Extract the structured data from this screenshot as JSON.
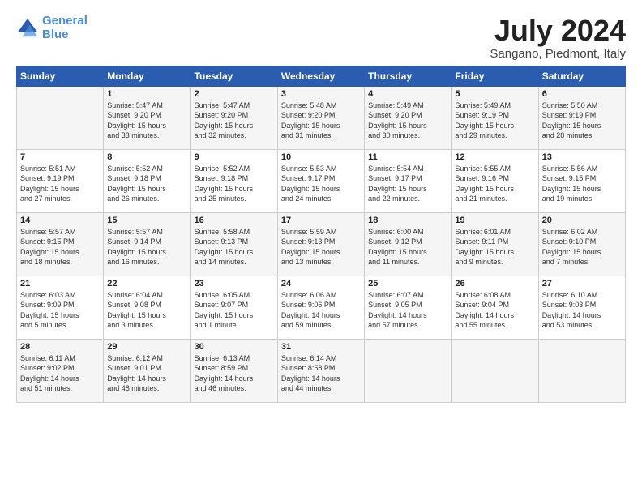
{
  "header": {
    "logo_line1": "General",
    "logo_line2": "Blue",
    "title": "July 2024",
    "location": "Sangano, Piedmont, Italy"
  },
  "days_of_week": [
    "Sunday",
    "Monday",
    "Tuesday",
    "Wednesday",
    "Thursday",
    "Friday",
    "Saturday"
  ],
  "weeks": [
    [
      {
        "day": "",
        "info": ""
      },
      {
        "day": "1",
        "info": "Sunrise: 5:47 AM\nSunset: 9:20 PM\nDaylight: 15 hours\nand 33 minutes."
      },
      {
        "day": "2",
        "info": "Sunrise: 5:47 AM\nSunset: 9:20 PM\nDaylight: 15 hours\nand 32 minutes."
      },
      {
        "day": "3",
        "info": "Sunrise: 5:48 AM\nSunset: 9:20 PM\nDaylight: 15 hours\nand 31 minutes."
      },
      {
        "day": "4",
        "info": "Sunrise: 5:49 AM\nSunset: 9:20 PM\nDaylight: 15 hours\nand 30 minutes."
      },
      {
        "day": "5",
        "info": "Sunrise: 5:49 AM\nSunset: 9:19 PM\nDaylight: 15 hours\nand 29 minutes."
      },
      {
        "day": "6",
        "info": "Sunrise: 5:50 AM\nSunset: 9:19 PM\nDaylight: 15 hours\nand 28 minutes."
      }
    ],
    [
      {
        "day": "7",
        "info": "Sunrise: 5:51 AM\nSunset: 9:19 PM\nDaylight: 15 hours\nand 27 minutes."
      },
      {
        "day": "8",
        "info": "Sunrise: 5:52 AM\nSunset: 9:18 PM\nDaylight: 15 hours\nand 26 minutes."
      },
      {
        "day": "9",
        "info": "Sunrise: 5:52 AM\nSunset: 9:18 PM\nDaylight: 15 hours\nand 25 minutes."
      },
      {
        "day": "10",
        "info": "Sunrise: 5:53 AM\nSunset: 9:17 PM\nDaylight: 15 hours\nand 24 minutes."
      },
      {
        "day": "11",
        "info": "Sunrise: 5:54 AM\nSunset: 9:17 PM\nDaylight: 15 hours\nand 22 minutes."
      },
      {
        "day": "12",
        "info": "Sunrise: 5:55 AM\nSunset: 9:16 PM\nDaylight: 15 hours\nand 21 minutes."
      },
      {
        "day": "13",
        "info": "Sunrise: 5:56 AM\nSunset: 9:15 PM\nDaylight: 15 hours\nand 19 minutes."
      }
    ],
    [
      {
        "day": "14",
        "info": "Sunrise: 5:57 AM\nSunset: 9:15 PM\nDaylight: 15 hours\nand 18 minutes."
      },
      {
        "day": "15",
        "info": "Sunrise: 5:57 AM\nSunset: 9:14 PM\nDaylight: 15 hours\nand 16 minutes."
      },
      {
        "day": "16",
        "info": "Sunrise: 5:58 AM\nSunset: 9:13 PM\nDaylight: 15 hours\nand 14 minutes."
      },
      {
        "day": "17",
        "info": "Sunrise: 5:59 AM\nSunset: 9:13 PM\nDaylight: 15 hours\nand 13 minutes."
      },
      {
        "day": "18",
        "info": "Sunrise: 6:00 AM\nSunset: 9:12 PM\nDaylight: 15 hours\nand 11 minutes."
      },
      {
        "day": "19",
        "info": "Sunrise: 6:01 AM\nSunset: 9:11 PM\nDaylight: 15 hours\nand 9 minutes."
      },
      {
        "day": "20",
        "info": "Sunrise: 6:02 AM\nSunset: 9:10 PM\nDaylight: 15 hours\nand 7 minutes."
      }
    ],
    [
      {
        "day": "21",
        "info": "Sunrise: 6:03 AM\nSunset: 9:09 PM\nDaylight: 15 hours\nand 5 minutes."
      },
      {
        "day": "22",
        "info": "Sunrise: 6:04 AM\nSunset: 9:08 PM\nDaylight: 15 hours\nand 3 minutes."
      },
      {
        "day": "23",
        "info": "Sunrise: 6:05 AM\nSunset: 9:07 PM\nDaylight: 15 hours\nand 1 minute."
      },
      {
        "day": "24",
        "info": "Sunrise: 6:06 AM\nSunset: 9:06 PM\nDaylight: 14 hours\nand 59 minutes."
      },
      {
        "day": "25",
        "info": "Sunrise: 6:07 AM\nSunset: 9:05 PM\nDaylight: 14 hours\nand 57 minutes."
      },
      {
        "day": "26",
        "info": "Sunrise: 6:08 AM\nSunset: 9:04 PM\nDaylight: 14 hours\nand 55 minutes."
      },
      {
        "day": "27",
        "info": "Sunrise: 6:10 AM\nSunset: 9:03 PM\nDaylight: 14 hours\nand 53 minutes."
      }
    ],
    [
      {
        "day": "28",
        "info": "Sunrise: 6:11 AM\nSunset: 9:02 PM\nDaylight: 14 hours\nand 51 minutes."
      },
      {
        "day": "29",
        "info": "Sunrise: 6:12 AM\nSunset: 9:01 PM\nDaylight: 14 hours\nand 48 minutes."
      },
      {
        "day": "30",
        "info": "Sunrise: 6:13 AM\nSunset: 8:59 PM\nDaylight: 14 hours\nand 46 minutes."
      },
      {
        "day": "31",
        "info": "Sunrise: 6:14 AM\nSunset: 8:58 PM\nDaylight: 14 hours\nand 44 minutes."
      },
      {
        "day": "",
        "info": ""
      },
      {
        "day": "",
        "info": ""
      },
      {
        "day": "",
        "info": ""
      }
    ]
  ]
}
